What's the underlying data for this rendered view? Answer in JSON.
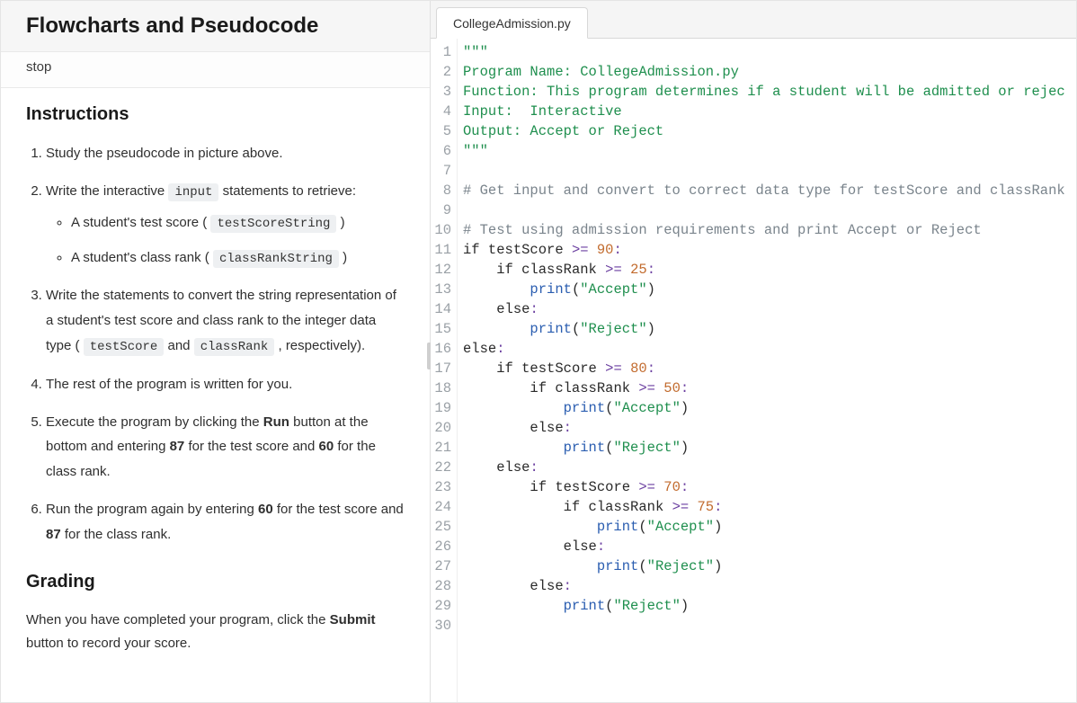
{
  "left": {
    "header_title": "Flowcharts and Pseudocode",
    "stop_text": "stop",
    "instructions_heading": "Instructions",
    "steps": {
      "s1": "Study the pseudocode in picture above.",
      "s2_pre": "Write the interactive ",
      "s2_code": "input",
      "s2_post": " statements to retrieve:",
      "s2a_pre": "A student's test score ( ",
      "s2a_code": "testScoreString",
      "s2a_post": " )",
      "s2b_pre": "A student's class rank ( ",
      "s2b_code": "classRankString",
      "s2b_post": " )",
      "s3_pre": "Write the statements to convert the string representation of a student's test score and class rank to the integer data type ( ",
      "s3_code1": "testScore",
      "s3_mid": " and ",
      "s3_code2": "classRank",
      "s3_post": " , respectively).",
      "s4": "The rest of the program is written for you.",
      "s5_pre": "Execute the program by clicking the ",
      "s5_b1": "Run",
      "s5_mid1": " button at the bottom and entering ",
      "s5_b2": "87",
      "s5_mid2": " for the test score and ",
      "s5_b3": "60",
      "s5_post": " for the class rank.",
      "s6_pre": "Run the program again by entering ",
      "s6_b1": "60",
      "s6_mid": " for the test score and ",
      "s6_b2": "87",
      "s6_post": " for the class rank."
    },
    "grading_heading": "Grading",
    "grading_para_pre": "When you have completed your program, click the ",
    "grading_para_b": "Submit",
    "grading_para_post": " button to record your score."
  },
  "right": {
    "tab_label": "CollegeAdmission.py",
    "code_lines": [
      {
        "n": 1,
        "tokens": [
          {
            "t": "\"\"\"",
            "c": "tok-str"
          }
        ]
      },
      {
        "n": 2,
        "tokens": [
          {
            "t": "Program Name: CollegeAdmission.py",
            "c": "tok-str"
          }
        ]
      },
      {
        "n": 3,
        "tokens": [
          {
            "t": "Function: This program determines if a student will be admitted or rejec",
            "c": "tok-str"
          }
        ]
      },
      {
        "n": 4,
        "tokens": [
          {
            "t": "Input:  Interactive",
            "c": "tok-str"
          }
        ]
      },
      {
        "n": 5,
        "tokens": [
          {
            "t": "Output: Accept or Reject",
            "c": "tok-str"
          }
        ]
      },
      {
        "n": 6,
        "tokens": [
          {
            "t": "\"\"\"",
            "c": "tok-str"
          }
        ]
      },
      {
        "n": 7,
        "tokens": [
          {
            "t": "",
            "c": ""
          }
        ]
      },
      {
        "n": 8,
        "tokens": [
          {
            "t": "# Get input and convert to correct data type for testScore and classRank",
            "c": "tok-cmt"
          }
        ]
      },
      {
        "n": 9,
        "tokens": [
          {
            "t": "",
            "c": ""
          }
        ]
      },
      {
        "n": 10,
        "tokens": [
          {
            "t": "# Test using admission requirements and print Accept or Reject",
            "c": "tok-cmt"
          }
        ]
      },
      {
        "n": 11,
        "tokens": [
          {
            "t": "if",
            "c": "tok-kw"
          },
          {
            "t": " testScore ",
            "c": ""
          },
          {
            "t": ">=",
            "c": "tok-op"
          },
          {
            "t": " ",
            "c": ""
          },
          {
            "t": "90",
            "c": "tok-num"
          },
          {
            "t": ":",
            "c": "tok-op"
          }
        ]
      },
      {
        "n": 12,
        "tokens": [
          {
            "t": "    ",
            "c": ""
          },
          {
            "t": "if",
            "c": "tok-kw"
          },
          {
            "t": " classRank ",
            "c": ""
          },
          {
            "t": ">=",
            "c": "tok-op"
          },
          {
            "t": " ",
            "c": ""
          },
          {
            "t": "25",
            "c": "tok-num"
          },
          {
            "t": ":",
            "c": "tok-op"
          }
        ]
      },
      {
        "n": 13,
        "tokens": [
          {
            "t": "        ",
            "c": ""
          },
          {
            "t": "print",
            "c": "tok-func"
          },
          {
            "t": "(",
            "c": ""
          },
          {
            "t": "\"Accept\"",
            "c": "tok-str"
          },
          {
            "t": ")",
            "c": ""
          }
        ]
      },
      {
        "n": 14,
        "tokens": [
          {
            "t": "    ",
            "c": ""
          },
          {
            "t": "else",
            "c": "tok-kw"
          },
          {
            "t": ":",
            "c": "tok-op"
          }
        ]
      },
      {
        "n": 15,
        "tokens": [
          {
            "t": "        ",
            "c": ""
          },
          {
            "t": "print",
            "c": "tok-func"
          },
          {
            "t": "(",
            "c": ""
          },
          {
            "t": "\"Reject\"",
            "c": "tok-str"
          },
          {
            "t": ")",
            "c": ""
          }
        ]
      },
      {
        "n": 16,
        "tokens": [
          {
            "t": "else",
            "c": "tok-kw"
          },
          {
            "t": ":",
            "c": "tok-op"
          }
        ]
      },
      {
        "n": 17,
        "tokens": [
          {
            "t": "    ",
            "c": ""
          },
          {
            "t": "if",
            "c": "tok-kw"
          },
          {
            "t": " testScore ",
            "c": ""
          },
          {
            "t": ">=",
            "c": "tok-op"
          },
          {
            "t": " ",
            "c": ""
          },
          {
            "t": "80",
            "c": "tok-num"
          },
          {
            "t": ":",
            "c": "tok-op"
          }
        ]
      },
      {
        "n": 18,
        "tokens": [
          {
            "t": "        ",
            "c": ""
          },
          {
            "t": "if",
            "c": "tok-kw"
          },
          {
            "t": " classRank ",
            "c": ""
          },
          {
            "t": ">=",
            "c": "tok-op"
          },
          {
            "t": " ",
            "c": ""
          },
          {
            "t": "50",
            "c": "tok-num"
          },
          {
            "t": ":",
            "c": "tok-op"
          }
        ]
      },
      {
        "n": 19,
        "tokens": [
          {
            "t": "            ",
            "c": ""
          },
          {
            "t": "print",
            "c": "tok-func"
          },
          {
            "t": "(",
            "c": ""
          },
          {
            "t": "\"Accept\"",
            "c": "tok-str"
          },
          {
            "t": ")",
            "c": ""
          }
        ]
      },
      {
        "n": 20,
        "tokens": [
          {
            "t": "        ",
            "c": ""
          },
          {
            "t": "else",
            "c": "tok-kw"
          },
          {
            "t": ":",
            "c": "tok-op"
          }
        ]
      },
      {
        "n": 21,
        "tokens": [
          {
            "t": "            ",
            "c": ""
          },
          {
            "t": "print",
            "c": "tok-func"
          },
          {
            "t": "(",
            "c": ""
          },
          {
            "t": "\"Reject\"",
            "c": "tok-str"
          },
          {
            "t": ")",
            "c": ""
          }
        ]
      },
      {
        "n": 22,
        "tokens": [
          {
            "t": "    ",
            "c": ""
          },
          {
            "t": "else",
            "c": "tok-kw"
          },
          {
            "t": ":",
            "c": "tok-op"
          }
        ]
      },
      {
        "n": 23,
        "tokens": [
          {
            "t": "        ",
            "c": ""
          },
          {
            "t": "if",
            "c": "tok-kw"
          },
          {
            "t": " testScore ",
            "c": ""
          },
          {
            "t": ">=",
            "c": "tok-op"
          },
          {
            "t": " ",
            "c": ""
          },
          {
            "t": "70",
            "c": "tok-num"
          },
          {
            "t": ":",
            "c": "tok-op"
          }
        ]
      },
      {
        "n": 24,
        "tokens": [
          {
            "t": "            ",
            "c": ""
          },
          {
            "t": "if",
            "c": "tok-kw"
          },
          {
            "t": " classRank ",
            "c": ""
          },
          {
            "t": ">=",
            "c": "tok-op"
          },
          {
            "t": " ",
            "c": ""
          },
          {
            "t": "75",
            "c": "tok-num"
          },
          {
            "t": ":",
            "c": "tok-op"
          }
        ]
      },
      {
        "n": 25,
        "tokens": [
          {
            "t": "                ",
            "c": ""
          },
          {
            "t": "print",
            "c": "tok-func"
          },
          {
            "t": "(",
            "c": ""
          },
          {
            "t": "\"Accept\"",
            "c": "tok-str"
          },
          {
            "t": ")",
            "c": ""
          }
        ]
      },
      {
        "n": 26,
        "tokens": [
          {
            "t": "            ",
            "c": ""
          },
          {
            "t": "else",
            "c": "tok-kw"
          },
          {
            "t": ":",
            "c": "tok-op"
          }
        ]
      },
      {
        "n": 27,
        "tokens": [
          {
            "t": "                ",
            "c": ""
          },
          {
            "t": "print",
            "c": "tok-func"
          },
          {
            "t": "(",
            "c": ""
          },
          {
            "t": "\"Reject\"",
            "c": "tok-str"
          },
          {
            "t": ")",
            "c": ""
          }
        ]
      },
      {
        "n": 28,
        "tokens": [
          {
            "t": "        ",
            "c": ""
          },
          {
            "t": "else",
            "c": "tok-kw"
          },
          {
            "t": ":",
            "c": "tok-op"
          }
        ]
      },
      {
        "n": 29,
        "tokens": [
          {
            "t": "            ",
            "c": ""
          },
          {
            "t": "print",
            "c": "tok-func"
          },
          {
            "t": "(",
            "c": ""
          },
          {
            "t": "\"Reject\"",
            "c": "tok-str"
          },
          {
            "t": ")",
            "c": ""
          }
        ]
      },
      {
        "n": 30,
        "tokens": [
          {
            "t": "",
            "c": ""
          }
        ]
      }
    ]
  }
}
